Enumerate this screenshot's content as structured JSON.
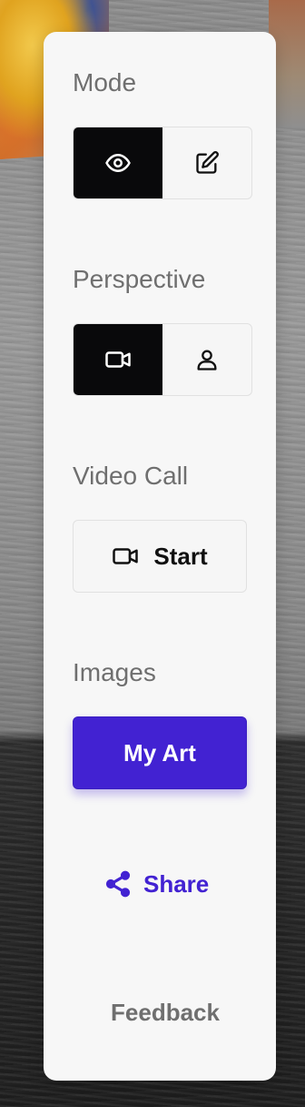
{
  "mode": {
    "label": "Mode",
    "options": [
      {
        "name": "view",
        "icon": "eye-icon",
        "active": true
      },
      {
        "name": "edit",
        "icon": "edit-icon",
        "active": false
      }
    ]
  },
  "perspective": {
    "label": "Perspective",
    "options": [
      {
        "name": "camera",
        "icon": "video-camera-icon",
        "active": true
      },
      {
        "name": "person",
        "icon": "user-icon",
        "active": false
      }
    ]
  },
  "video_call": {
    "label": "Video Call",
    "start_label": "Start",
    "icon": "video-camera-icon"
  },
  "images": {
    "label": "Images",
    "my_art_label": "My Art"
  },
  "share": {
    "label": "Share",
    "icon": "share-icon"
  },
  "feedback": {
    "label": "Feedback"
  },
  "colors": {
    "accent": "#4222d2",
    "active_segment": "#09090b",
    "panel_bg": "#f7f7f7",
    "label_gray": "#6f6f6f"
  }
}
